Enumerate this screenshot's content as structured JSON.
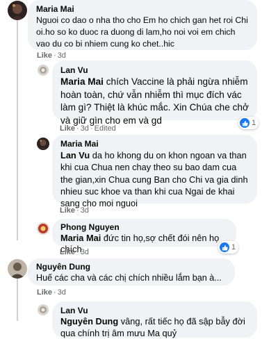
{
  "comments": [
    {
      "author": "Maria Mai",
      "text": "Nguoi co dao o nha tho cho Em ho chich gan het roi Chi oi.ho so ko duoc ra duong di lam,ho noi voi em chich vao du co bi nhiem cung ko chet..hic",
      "like_label": "Like",
      "time": "3d"
    },
    {
      "author": "Lan Vu",
      "mention": "Maria Mai",
      "text": " chích Vaccine là phải ngừa nhiễm hoàn toàn, chứ vẫn nhiễm thì mục đích vác làm gì? Thiệt là khúc mắc. Xin Chúa che chở và giữ gìn cho em và gd",
      "like_label": "Like",
      "time": "3d",
      "edited": "Edited",
      "reaction_count": "1"
    },
    {
      "author": "Maria Mai",
      "mention": "Lan Vu",
      "text": " da ho khong du on khon ngoan va than khi cua Chua nen chay theo su bao dam cua the gian,xin Chua cung Ban cho Chi va gia dinh nhieu suc khoe va than khi cua Ngai de khai sang cho moi nguoi",
      "like_label": "Like",
      "time": "3d"
    },
    {
      "author": "Phong Nguyen",
      "mention": "Maria Mai",
      "text": " đức tin họ,sợ chết đói nên họ chích",
      "like_label": "Like",
      "time": "3d",
      "reaction_count": "1"
    },
    {
      "author": "Nguyên Dung",
      "text": "Huế các cha và các chị chích nhiều lắm bạn à...",
      "like_label": "Like",
      "time": "3d"
    },
    {
      "author": "Lan Vu",
      "mention": "Nguyên Dung",
      "text": " vâng, rất tiếc họ đã sập bẫy đời qua chính trị âm mưu Ma quỷ"
    }
  ],
  "colors": {
    "bubble": "#f0f2f5",
    "meta": "#65676b",
    "like_reaction": "#1877f2",
    "text": "#050505"
  },
  "icons": {
    "reaction": "thumbs-up-icon"
  }
}
